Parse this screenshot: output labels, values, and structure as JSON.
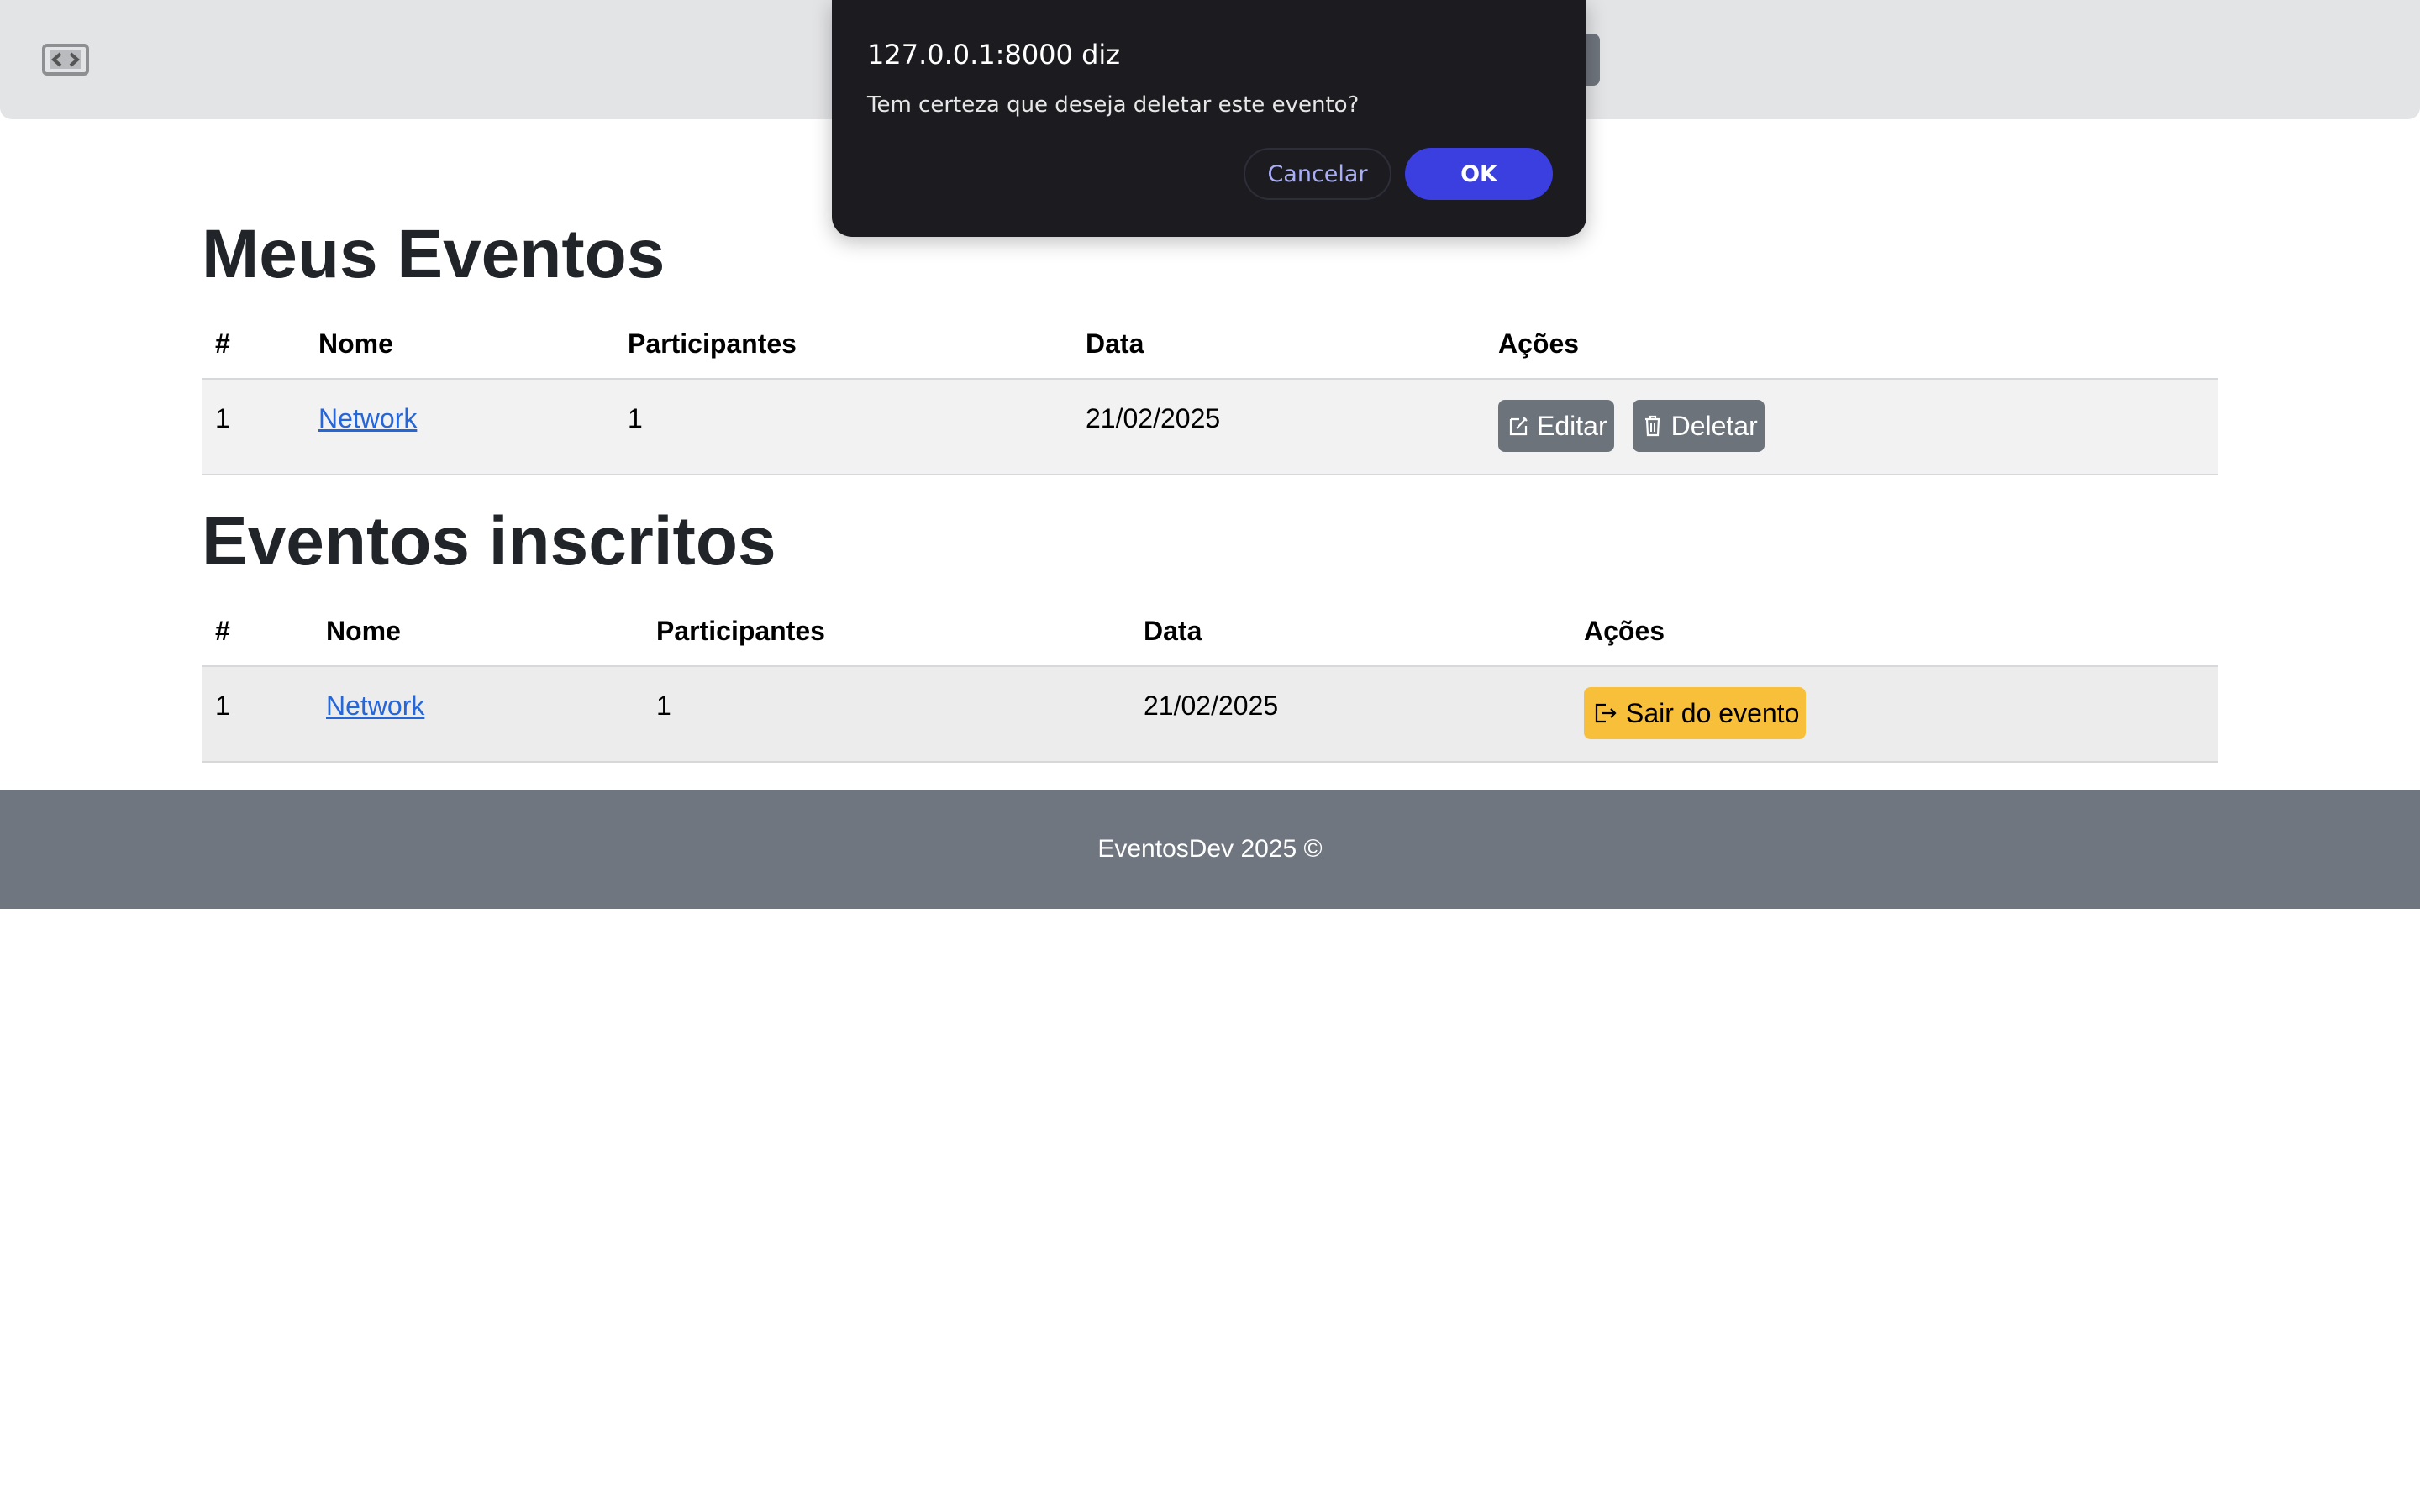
{
  "navbar": {
    "logo_icon": "code-brackets-logo"
  },
  "dialog": {
    "title": "127.0.0.1:8000 diz",
    "message": "Tem certeza que deseja deletar este evento?",
    "cancel_label": "Cancelar",
    "ok_label": "OK",
    "accent_color": "#3b3fe0"
  },
  "my_events": {
    "title": "Meus Eventos",
    "headers": [
      "#",
      "Nome",
      "Participantes",
      "Data",
      "Ações"
    ],
    "rows": [
      {
        "index": "1",
        "name": "Network",
        "participants": "1",
        "date": "21/02/2025",
        "edit_label": "Editar",
        "edit_icon": "edit-icon",
        "delete_label": "Deletar",
        "delete_icon": "trash-icon"
      }
    ]
  },
  "subscribed_events": {
    "title": "Eventos inscritos",
    "headers": [
      "#",
      "Nome",
      "Participantes",
      "Data",
      "Ações"
    ],
    "rows": [
      {
        "index": "1",
        "name": "Network",
        "participants": "1",
        "date": "21/02/2025",
        "leave_label": "Sair do evento",
        "leave_icon": "exit-icon",
        "leave_color": "#f8c03a"
      }
    ]
  },
  "footer": {
    "text": "EventosDev 2025 ©"
  }
}
